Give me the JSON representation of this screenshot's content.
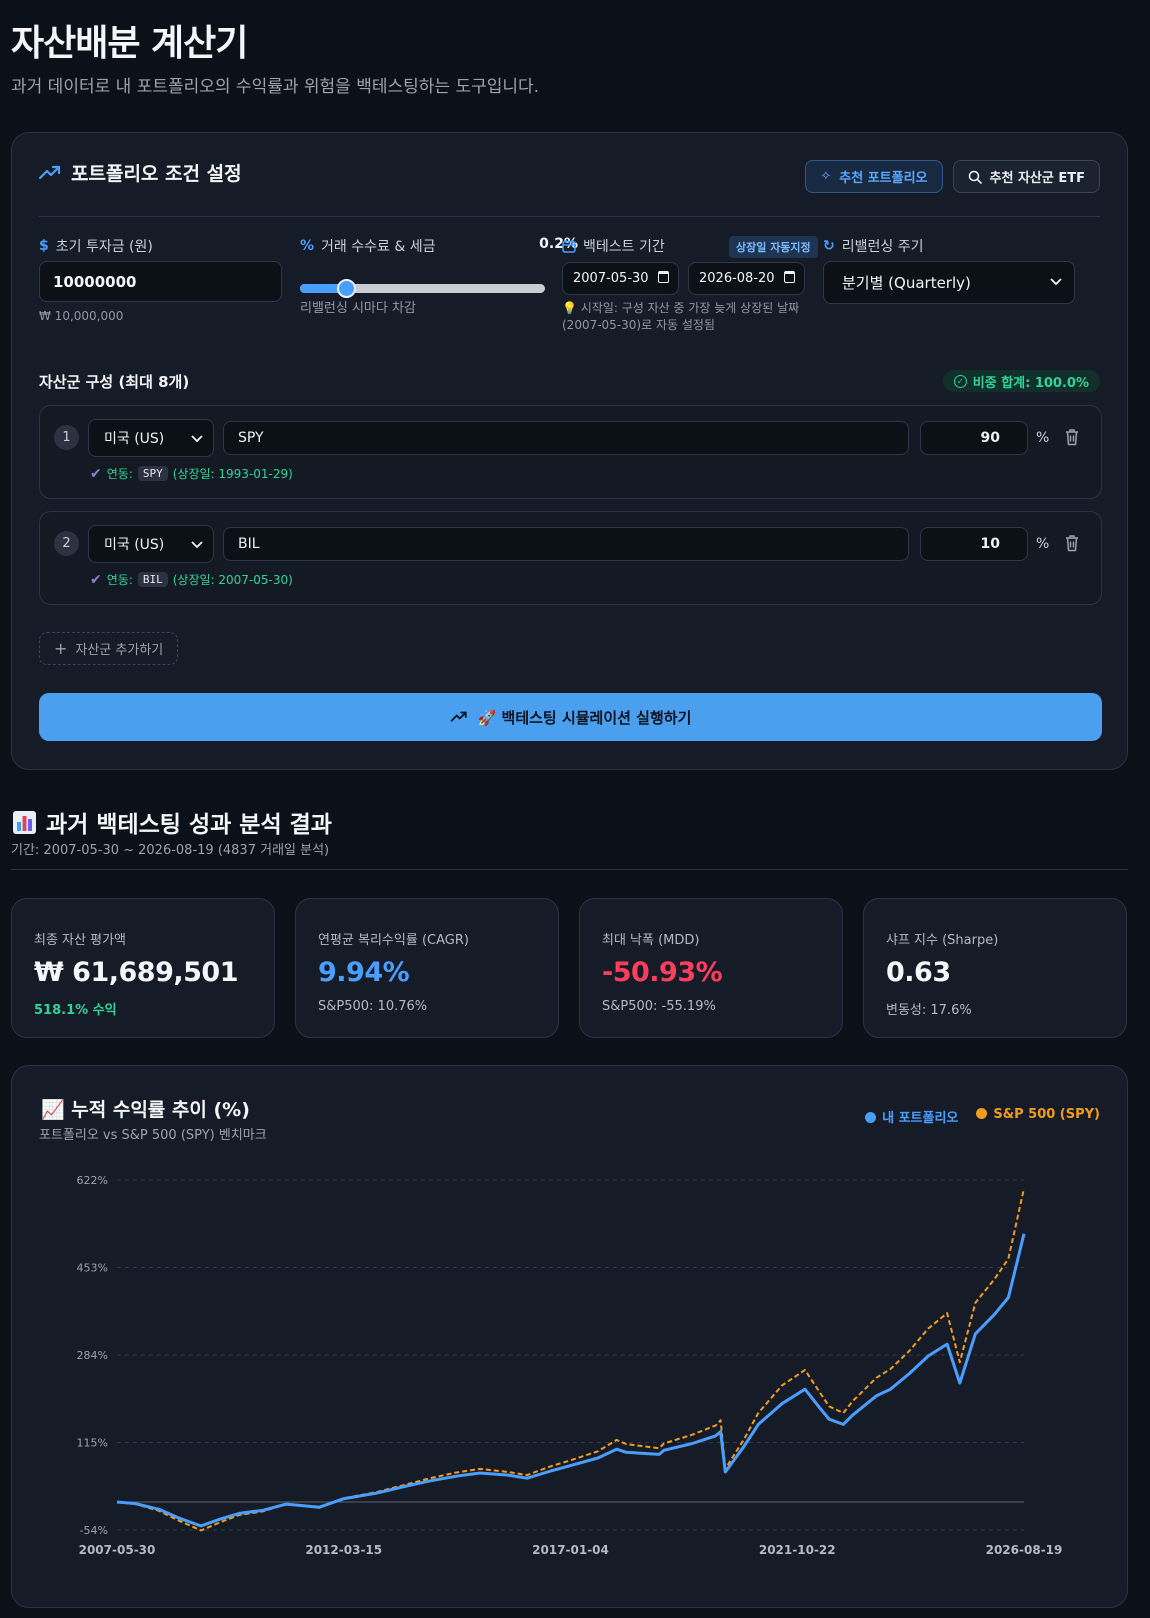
{
  "page": {
    "title": "자산배분 계산기",
    "subtitle": "과거 데이터로 내 포트폴리오의 수익률과 위험을 백테스팅하는 도구입니다."
  },
  "settings": {
    "heading": "포트폴리오 조건 설정",
    "btn_recommend_portfolio": "추천 포트폴리오",
    "btn_recommend_etf": "추천 자산군 ETF",
    "initial": {
      "label": "초기 투자금 (원)",
      "value": "10000000",
      "formatted": "₩ 10,000,000"
    },
    "fee": {
      "label": "거래 수수료 & 세금",
      "value": "0.2%",
      "level_fraction": 0.15,
      "note": "리밸런싱 시마다 차감"
    },
    "period": {
      "label": "백테스트 기간",
      "badge": "상장일 자동지정",
      "start": "2007-05-30",
      "end": "2026-08-20",
      "note_line1": "💡 시작일: 구성 자산 중 가장 늦게 상장된 날짜",
      "note_line2": "(2007-05-30)로 자동 설정됨"
    },
    "rebalance": {
      "label": "리밸런싱 주기",
      "value": "분기별 (Quarterly)"
    },
    "assets_heading": "자산군 구성 (최대 8개)",
    "weight_sum": "비중 합계: 100.0%",
    "assets": [
      {
        "idx": "1",
        "country": "미국 (US)",
        "ticker": "SPY",
        "weight": "90",
        "linked_label": "연동:",
        "code": "SPY",
        "listed": "(상장일: 1993-01-29)"
      },
      {
        "idx": "2",
        "country": "미국 (US)",
        "ticker": "BIL",
        "weight": "10",
        "linked_label": "연동:",
        "code": "BIL",
        "listed": "(상장일: 2007-05-30)"
      }
    ],
    "percent_sign": "%",
    "add_asset": "자산군 추가하기",
    "run_button": "🚀 백테스팅 시뮬레이션 실행하기"
  },
  "results": {
    "heading": "과거 백테스팅 성과 분석 결과",
    "period": "기간: 2007-05-30 ~ 2026-08-19 (4837 거래일 분석)",
    "kpis": [
      {
        "label": "최종 자산 평가액",
        "value": "₩ 61,689,501",
        "sub": "518.1% 수익",
        "value_color": "#f4f6f9",
        "sub_color": "#2fd49a"
      },
      {
        "label": "연평균 복리수익률 (CAGR)",
        "value": "9.94%",
        "sub": "S&P500: 10.76%",
        "value_color": "#4a9eff",
        "sub_color": "#b3bac4"
      },
      {
        "label": "최대 낙폭 (MDD)",
        "value": "-50.93%",
        "sub": "S&P500: -55.19%",
        "value_color": "#ff3d5e",
        "sub_color": "#b3bac4"
      },
      {
        "label": "샤프 지수 (Sharpe)",
        "value": "0.63",
        "sub": "변동성: 17.6%",
        "value_color": "#f4f6f9",
        "sub_color": "#b3bac4"
      }
    ]
  },
  "chart_data": {
    "type": "line",
    "title": "📈 누적 수익률 추이 (%)",
    "subtitle": "포트폴리오 vs S&P 500 (SPY) 벤치마크",
    "y_ticks": [
      "622%",
      "453%",
      "284%",
      "115%",
      "-54%"
    ],
    "ylim": [
      -54,
      622
    ],
    "x_ticks": [
      "2007-05-30",
      "2012-03-15",
      "2017-01-04",
      "2021-10-22",
      "2026-08-19"
    ],
    "grid": true,
    "legend_position": "top-right",
    "series": [
      {
        "name": "내 포트폴리오",
        "color": "#4a9eff",
        "x": [
          2007.41,
          2007.8,
          2008.3,
          2008.7,
          2009.0,
          2009.19,
          2009.6,
          2010.0,
          2010.5,
          2011.0,
          2011.7,
          2012.2,
          2012.9,
          2013.5,
          2014.0,
          2014.6,
          2015.1,
          2015.7,
          2016.1,
          2016.6,
          2017.0,
          2017.6,
          2018.0,
          2018.2,
          2018.9,
          2019.0,
          2019.6,
          2020.1,
          2020.2,
          2020.3,
          2020.7,
          2021.0,
          2021.5,
          2021.99,
          2022.3,
          2022.5,
          2022.8,
          2023.0,
          2023.5,
          2023.8,
          2024.2,
          2024.6,
          2025.0,
          2025.27,
          2025.6,
          2026.0,
          2026.3,
          2026.63
        ],
        "y": [
          0,
          -3,
          -14,
          -30,
          -40,
          -46,
          -33,
          -22,
          -16,
          -4,
          -10,
          6,
          17,
          30,
          40,
          50,
          56,
          52,
          46,
          60,
          70,
          85,
          102,
          96,
          92,
          100,
          113,
          128,
          136,
          58,
          108,
          150,
          190,
          218,
          182,
          160,
          150,
          168,
          205,
          218,
          248,
          282,
          305,
          230,
          325,
          362,
          395,
          518
        ]
      },
      {
        "name": "S&P 500 (SPY)",
        "color": "#f39c1a",
        "dashed": true,
        "x": [
          2007.41,
          2007.8,
          2008.3,
          2008.7,
          2009.0,
          2009.19,
          2009.6,
          2010.0,
          2010.5,
          2011.0,
          2011.7,
          2012.2,
          2012.9,
          2013.5,
          2014.0,
          2014.6,
          2015.1,
          2015.7,
          2016.1,
          2016.6,
          2017.0,
          2017.6,
          2018.0,
          2018.2,
          2018.9,
          2019.0,
          2019.6,
          2020.1,
          2020.2,
          2020.3,
          2020.7,
          2021.0,
          2021.5,
          2021.99,
          2022.3,
          2022.5,
          2022.8,
          2023.0,
          2023.5,
          2023.8,
          2024.2,
          2024.6,
          2025.0,
          2025.27,
          2025.6,
          2026.0,
          2026.3,
          2026.63
        ],
        "y": [
          0,
          -4,
          -17,
          -35,
          -47,
          -55,
          -39,
          -25,
          -18,
          -4,
          -11,
          7,
          19,
          33,
          45,
          57,
          64,
          58,
          52,
          69,
          80,
          98,
          120,
          112,
          104,
          113,
          130,
          148,
          158,
          64,
          122,
          172,
          225,
          255,
          212,
          185,
          172,
          195,
          240,
          257,
          292,
          335,
          365,
          270,
          385,
          430,
          470,
          606
        ]
      }
    ]
  }
}
